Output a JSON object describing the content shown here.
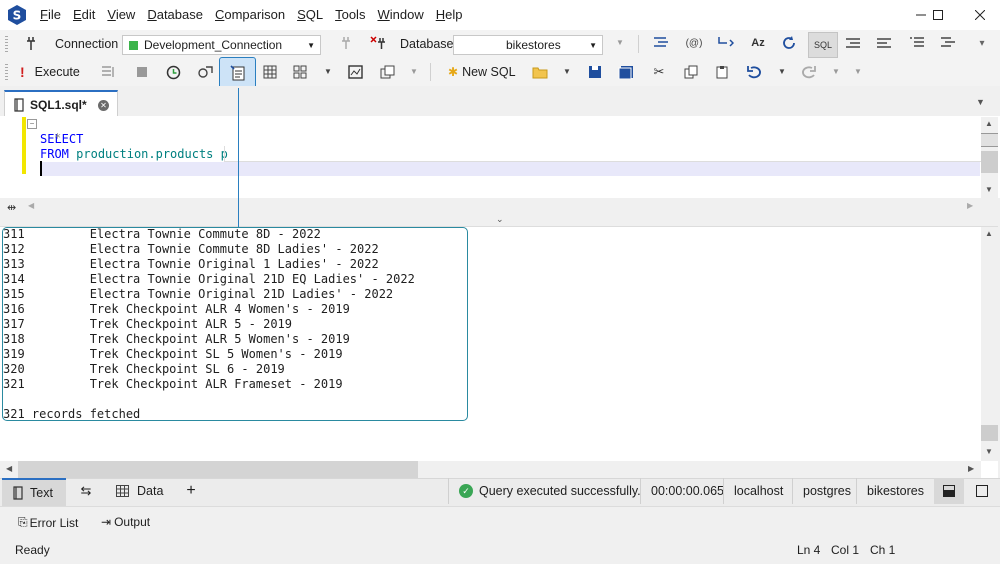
{
  "menu": [
    "File",
    "Edit",
    "View",
    "Database",
    "Comparison",
    "SQL",
    "Tools",
    "Window",
    "Help"
  ],
  "menu_underline": [
    "F",
    "E",
    "V",
    "D",
    "C",
    "S",
    "T",
    "W",
    "H"
  ],
  "toolbar1": {
    "connection_label": "Connection",
    "connection_value": "Development_Connection",
    "database_label": "Database",
    "database_value": "bikestores"
  },
  "toolbar2": {
    "execute_label": "Execute",
    "new_sql_label": "New SQL"
  },
  "tab": {
    "title": "SQL1.sql*"
  },
  "editor": {
    "line1": "SELECT",
    "line2": "*",
    "line3_kw": "FROM",
    "line3_obj": "production.products p"
  },
  "output": {
    "rows": [
      {
        "id": "311",
        "name": "Electra Townie Commute 8D - 2022"
      },
      {
        "id": "312",
        "name": "Electra Townie Commute 8D Ladies' - 2022"
      },
      {
        "id": "313",
        "name": "Electra Townie Original 1 Ladies' - 2022"
      },
      {
        "id": "314",
        "name": "Electra Townie Original 21D EQ Ladies' - 2022"
      },
      {
        "id": "315",
        "name": "Electra Townie Original 21D Ladies' - 2022"
      },
      {
        "id": "316",
        "name": "Trek Checkpoint ALR 4 Women's - 2019"
      },
      {
        "id": "317",
        "name": "Trek Checkpoint ALR 5 - 2019"
      },
      {
        "id": "318",
        "name": "Trek Checkpoint ALR 5 Women's - 2019"
      },
      {
        "id": "319",
        "name": "Trek Checkpoint SL 5 Women's - 2019"
      },
      {
        "id": "320",
        "name": "Trek Checkpoint SL 6 - 2019"
      },
      {
        "id": "321",
        "name": "Trek Checkpoint ALR Frameset - 2019"
      }
    ],
    "summary": "321 records fetched"
  },
  "result_tabs": {
    "text": "Text",
    "data": "Data"
  },
  "status": {
    "message": "Query executed successfully.",
    "elapsed": "00:00:00.065",
    "host": "localhost",
    "user": "postgres",
    "database": "bikestores"
  },
  "panels": {
    "error_list": "Error List",
    "output": "Output"
  },
  "statusbar": {
    "ready": "Ready",
    "ln": "Ln 4",
    "col": "Col 1",
    "ch": "Ch 1"
  },
  "colors": {
    "accent": "#2b6fc2",
    "success": "#3aa655",
    "keyword": "#0000ff",
    "object": "#008080",
    "highlight": "#2a8aa0"
  }
}
